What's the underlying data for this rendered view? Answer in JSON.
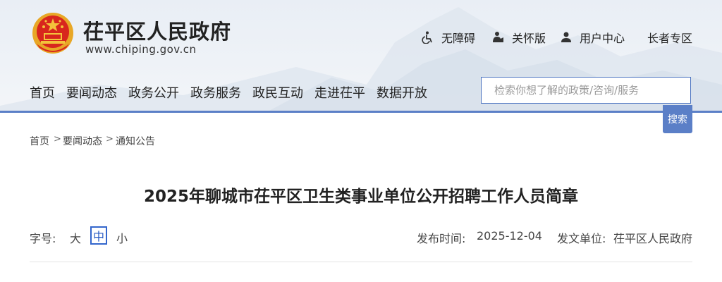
{
  "site": {
    "title": "茌平区人民政府",
    "url": "www.chiping.gov.cn"
  },
  "toolbar": {
    "accessibility": {
      "label": "无障碍",
      "icon": "wheelchair-icon"
    },
    "care_mode": {
      "label": "关怀版",
      "icon": "care-person-icon"
    },
    "user_center": {
      "label": "用户中心",
      "icon": "user-icon"
    },
    "elderly_zone": {
      "label": "长者专区"
    }
  },
  "nav": {
    "items": [
      "首页",
      "要闻动态",
      "政务公开",
      "政务服务",
      "政民互动",
      "走进茌平",
      "数据开放"
    ]
  },
  "search": {
    "placeholder": "检索你想了解的政策/咨询/服务",
    "button": "搜索"
  },
  "breadcrumb": {
    "items": [
      "首页",
      "要闻动态",
      "通知公告"
    ],
    "separator": ">"
  },
  "article": {
    "title": "2025年聊城市茌平区卫生类事业单位公开招聘工作人员简章",
    "font_size_label": "字号:",
    "font_sizes": [
      "大",
      "中",
      "小"
    ],
    "font_size_selected": "中",
    "publish_time_label": "发布时间:",
    "publish_time": "2025-12-04",
    "issuer_label": "发文单位:",
    "issuer": "茌平区人民政府"
  },
  "colors": {
    "accent": "#5b7fc7",
    "header_bg": "#eaeff5",
    "emblem_red": "#d8261d",
    "emblem_gold": "#f3c23b"
  }
}
